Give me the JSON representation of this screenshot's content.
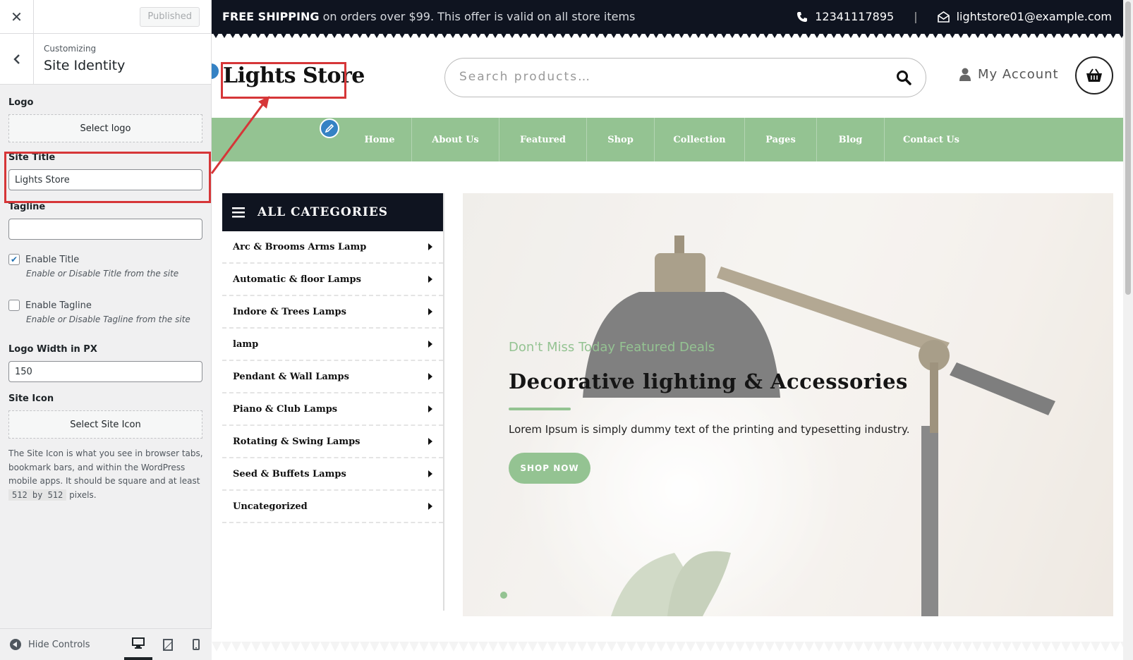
{
  "customizer": {
    "published_label": "Published",
    "breadcrumb": "Customizing",
    "section_title": "Site Identity",
    "logo": {
      "label": "Logo",
      "button": "Select logo"
    },
    "site_title": {
      "label": "Site Title",
      "value": "Lights Store"
    },
    "tagline": {
      "label": "Tagline",
      "value": ""
    },
    "enable_title": {
      "label": "Enable Title",
      "checked": true,
      "desc": "Enable or Disable Title from the site"
    },
    "enable_tagline": {
      "label": "Enable Tagline",
      "checked": false,
      "desc": "Enable or Disable Tagline from the site"
    },
    "logo_width": {
      "label": "Logo Width in PX",
      "value": "150"
    },
    "site_icon": {
      "label": "Site Icon",
      "button": "Select Site Icon",
      "help_before": "The Site Icon is what you see in browser tabs, bookmark bars, and within the WordPress mobile apps. It should be square and at least",
      "help_code": "512 by 512",
      "help_after": "pixels."
    },
    "hide_controls": "Hide Controls"
  },
  "site": {
    "topbar": {
      "promo_bold": "FREE SHIPPING",
      "promo_rest": "on orders over $99. This offer is valid on all store items",
      "phone": "12341117895",
      "email": "lightstore01@example.com"
    },
    "logo_text": "Lights Store",
    "search_placeholder": "Search products…",
    "account_label": "My Account",
    "nav": [
      "Home",
      "About Us",
      "Featured",
      "Shop",
      "Collection",
      "Pages",
      "Blog",
      "Contact Us"
    ],
    "categories_title": "ALL CATEGORIES",
    "categories": [
      "Arc & Brooms Arms Lamp",
      "Automatic & floor Lamps",
      "Indore & Trees Lamps",
      "lamp",
      "Pendant & Wall Lamps",
      "Piano & Club Lamps",
      "Rotating & Swing Lamps",
      "Seed & Buffets Lamps",
      "Uncategorized"
    ],
    "hero": {
      "subtitle": "Don't Miss Today Featured Deals",
      "title": "Decorative lighting & Accessories",
      "text": "Lorem Ipsum is simply dummy text of the printing and typesetting industry.",
      "button": "SHOP NOW"
    }
  },
  "colors": {
    "accent_green": "#94c392",
    "dark": "#0f1420",
    "highlight_red": "#d63638"
  }
}
